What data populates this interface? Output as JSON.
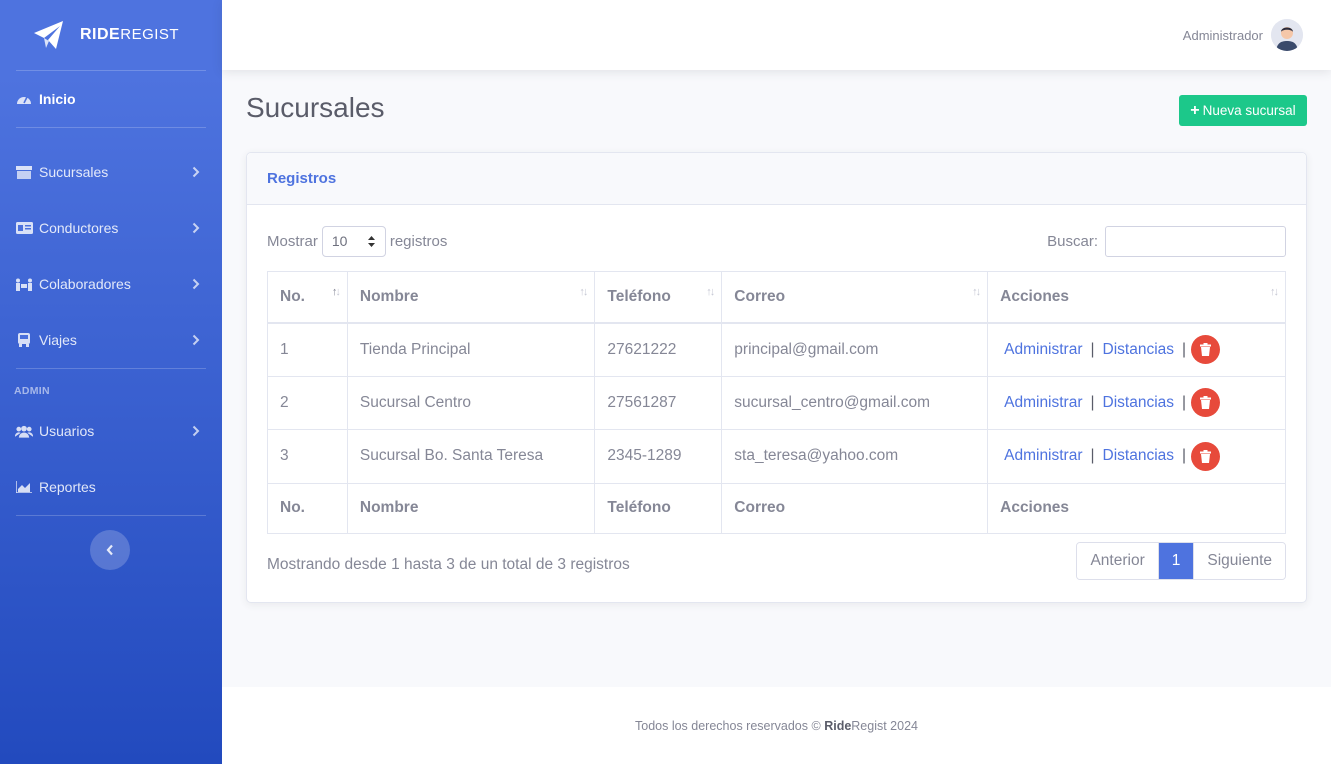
{
  "brand": {
    "bold": "RIDE",
    "rest": "REGIST"
  },
  "sidebar": {
    "home": "Inicio",
    "items": [
      {
        "label": "Sucursales",
        "icon": "store-icon"
      },
      {
        "label": "Conductores",
        "icon": "id-card-icon"
      },
      {
        "label": "Colaboradores",
        "icon": "people-carry-icon"
      },
      {
        "label": "Viajes",
        "icon": "bus-icon"
      }
    ],
    "admin_heading": "ADMIN",
    "admin_items": [
      {
        "label": "Usuarios",
        "icon": "users-icon"
      },
      {
        "label": "Reportes",
        "icon": "chart-area-icon"
      }
    ]
  },
  "topbar": {
    "user": "Administrador"
  },
  "page": {
    "title": "Sucursales",
    "new_button": "Nueva sucursal"
  },
  "card": {
    "header": "Registros"
  },
  "controls": {
    "show_prefix": "Mostrar",
    "show_value": "10",
    "show_suffix": "registros",
    "search_label": "Buscar:"
  },
  "table": {
    "columns": [
      "No.",
      "Nombre",
      "Teléfono",
      "Correo",
      "Acciones"
    ],
    "rows": [
      {
        "no": "1",
        "nombre": "Tienda Principal",
        "telefono": "27621222",
        "correo": "principal@gmail.com"
      },
      {
        "no": "2",
        "nombre": "Sucursal Centro",
        "telefono": "27561287",
        "correo": "sucursal_centro@gmail.com"
      },
      {
        "no": "3",
        "nombre": "Sucursal Bo. Santa Teresa",
        "telefono": "2345-1289",
        "correo": "sta_teresa@yahoo.com"
      }
    ],
    "action_admin": "Administrar",
    "action_dist": "Distancias",
    "action_sep": "|"
  },
  "pagination": {
    "info": "Mostrando desde 1 hasta 3 de un total de 3 registros",
    "prev": "Anterior",
    "current": "1",
    "next": "Siguiente"
  },
  "footer": {
    "prefix": "Todos los derechos reservados ©",
    "brand_bold": "Ride",
    "brand_rest": "Regist 2024"
  },
  "colors": {
    "primary": "#4e73df",
    "success": "#1cc88a",
    "danger": "#e74a3b"
  }
}
